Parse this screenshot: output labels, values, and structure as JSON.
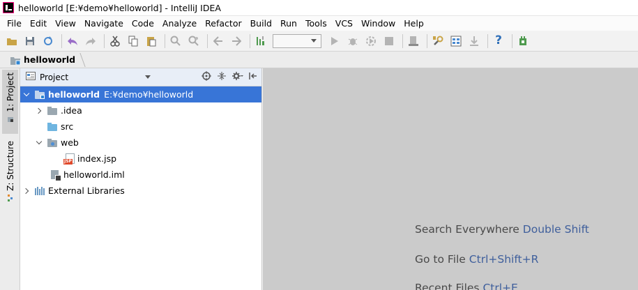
{
  "window": {
    "title": "helloworld [E:¥demo¥helloworld] - IntelliJ IDEA"
  },
  "menu": {
    "items": [
      "File",
      "Edit",
      "View",
      "Navigate",
      "Code",
      "Analyze",
      "Refactor",
      "Build",
      "Run",
      "Tools",
      "VCS",
      "Window",
      "Help"
    ]
  },
  "toolbar": {
    "icons": [
      "open-icon",
      "save-all-icon",
      "sync-icon",
      "undo-icon",
      "redo-icon",
      "cut-icon",
      "copy-icon",
      "paste-icon",
      "find-icon",
      "replace-icon",
      "back-icon",
      "forward-icon",
      "make-project-icon",
      "run-icon",
      "debug-icon",
      "coverage-icon",
      "stop-icon",
      "deploy-icon",
      "project-structure-icon",
      "settings-icon",
      "sdk-icon",
      "help-icon",
      "plugin-icon"
    ]
  },
  "navbar": {
    "crumb": "helloworld"
  },
  "stripe": {
    "project_tab": "1: Project",
    "structure_tab": "Z: Structure"
  },
  "project_panel": {
    "title": "Project",
    "tree": {
      "root_name": "helloworld",
      "root_path": "E:¥demo¥helloworld",
      "idea": ".idea",
      "src": "src",
      "web": "web",
      "index_jsp": "index.jsp",
      "iml": "helloworld.iml",
      "libraries": "External Libraries"
    }
  },
  "editor": {
    "hint1_label": "Search Everywhere",
    "hint1_key": "Double Shift",
    "hint2_label": "Go to File",
    "hint2_key": "Ctrl+Shift+R",
    "hint3_label": "Recent Files",
    "hint3_key": "Ctrl+E"
  },
  "colors": {
    "selection": "#3875d7",
    "editor_bg": "#cbcbcb",
    "shortcut_key": "#3f5f9c"
  }
}
